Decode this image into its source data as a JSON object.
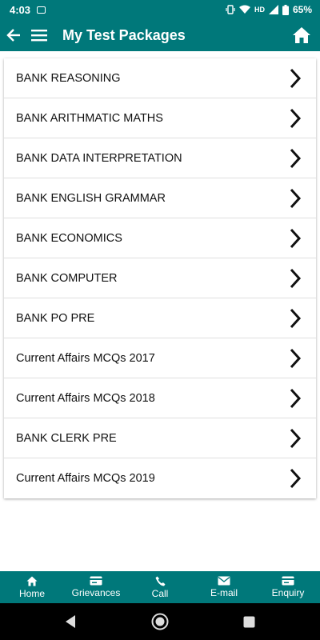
{
  "status_bar": {
    "time": "4:03",
    "network": "HD",
    "battery": "65%"
  },
  "app_bar": {
    "title": "My Test Packages"
  },
  "packages": [
    {
      "label": "BANK REASONING"
    },
    {
      "label": "BANK ARITHMATIC MATHS"
    },
    {
      "label": "BANK DATA INTERPRETATION"
    },
    {
      "label": "BANK ENGLISH GRAMMAR"
    },
    {
      "label": "BANK ECONOMICS"
    },
    {
      "label": "BANK COMPUTER"
    },
    {
      "label": "BANK PO PRE"
    },
    {
      "label": "Current Affairs MCQs 2017"
    },
    {
      "label": "Current Affairs MCQs 2018"
    },
    {
      "label": "BANK CLERK PRE"
    },
    {
      "label": "Current Affairs MCQs 2019"
    }
  ],
  "bottom_nav": [
    {
      "label": "Home",
      "icon": "home-icon"
    },
    {
      "label": "Grievances",
      "icon": "card-icon"
    },
    {
      "label": "Call",
      "icon": "phone-icon"
    },
    {
      "label": "E-mail",
      "icon": "mail-icon"
    },
    {
      "label": "Enquiry",
      "icon": "card-icon"
    }
  ],
  "colors": {
    "primary": "#00787a",
    "text": "#111111",
    "divider": "#dedede"
  }
}
